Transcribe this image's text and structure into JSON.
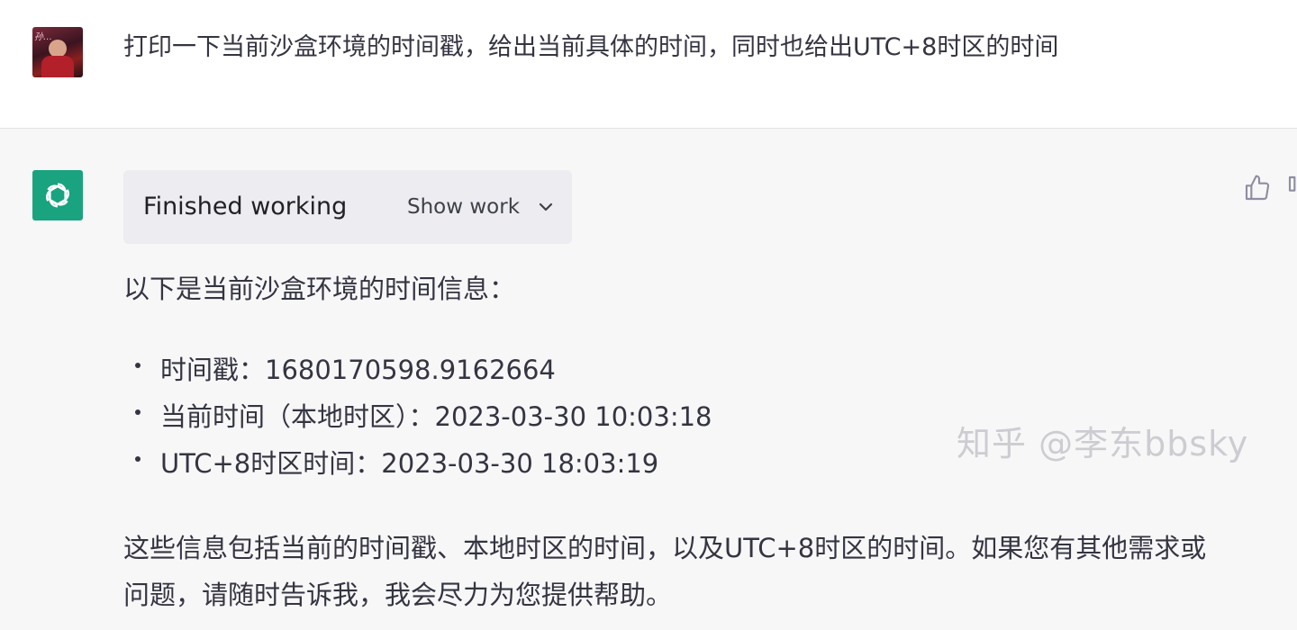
{
  "user": {
    "avatar_alt": "user-avatar",
    "avatar_sign": "孙…",
    "message": "打印一下当前沙盒环境的时间戳，给出当前具体的时间，同时也给出UTC+8时区的时间"
  },
  "assistant": {
    "avatar_icon": "openai-logo-icon",
    "work_status": "Finished working",
    "show_work_label": "Show work",
    "intro": "以下是当前沙盒环境的时间信息：",
    "bullets": [
      "时间戳：1680170598.9162664",
      "当前时间（本地时区）：2023-03-30 10:03:18",
      "UTC+8时区时间：2023-03-30 18:03:19"
    ],
    "outro": "这些信息包括当前的时间戳、本地时区的时间，以及UTC+8时区的时间。如果您有其他需求或问题，请随时告诉我，我会尽力为您提供帮助。"
  },
  "watermark": "知乎 @李东bbsky",
  "colors": {
    "assistant_bg": "#f7f7f8",
    "bot_avatar_bg": "#19a37f",
    "work_box_bg": "#ececf1",
    "text": "#343541"
  }
}
